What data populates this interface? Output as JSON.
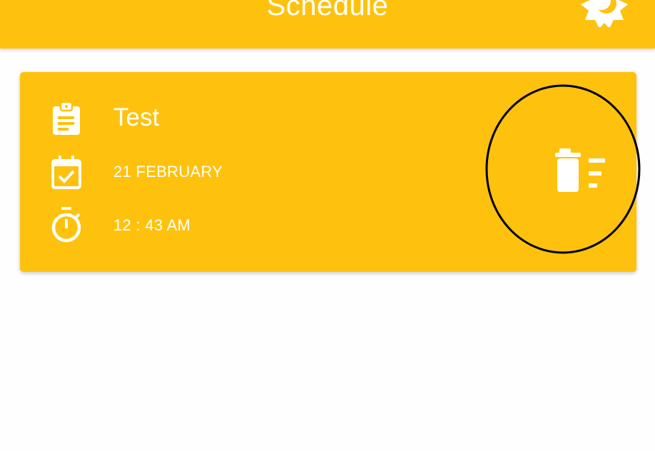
{
  "appbar": {
    "title": "Schedule",
    "action_icon": "theme-toggle-icon",
    "color": "#FEC20E"
  },
  "schedule_items": [
    {
      "title": "Test",
      "date": "21 FEBRUARY",
      "time": "12 : 43 AM",
      "title_icon": "clipboard-icon",
      "date_icon": "calendar-check-icon",
      "time_icon": "stopwatch-icon",
      "delete_icon": "delete-sweep-icon"
    }
  ],
  "colors": {
    "accent": "#FEC20E",
    "text_on_accent": "#FFFFFF",
    "background": "#FEFEFE",
    "annotation_circle": "#000000"
  }
}
